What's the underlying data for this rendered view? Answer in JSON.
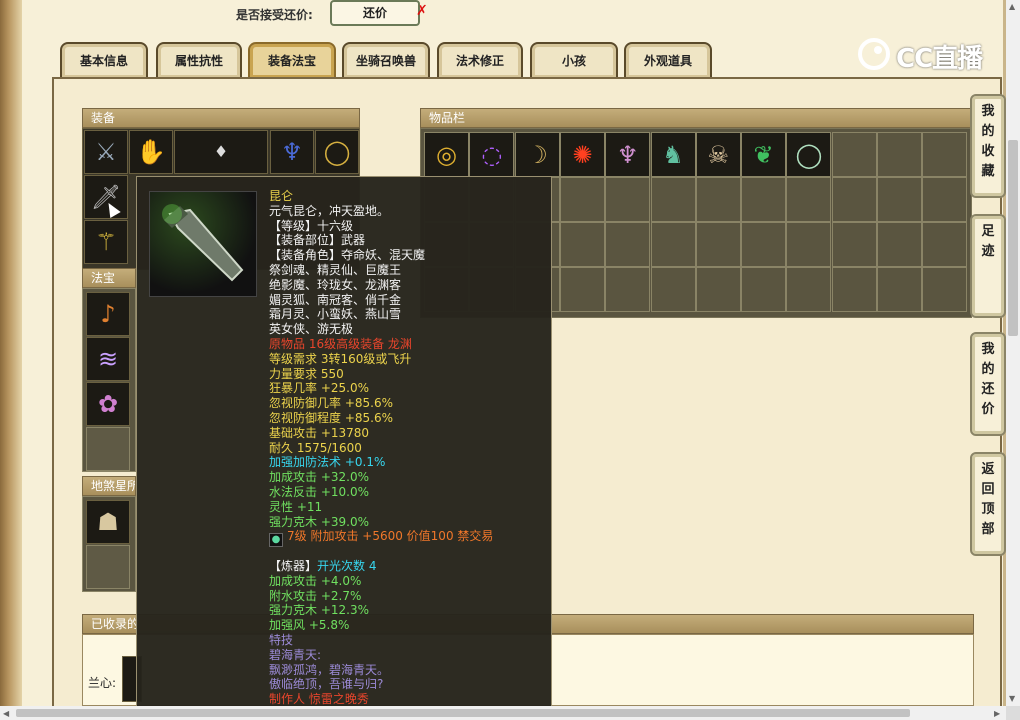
{
  "accept_offer_label": "是否接受还价:",
  "counter_offer_button": "还价",
  "tabs": [
    "基本信息",
    "属性抗性",
    "装备法宝",
    "坐骑召唤兽",
    "法术修正",
    "小孩",
    "外观道具"
  ],
  "active_tab": "装备法宝",
  "logo": "CC直播",
  "sections": {
    "equipment": "装备",
    "inventory": "物品栏",
    "fabao": "法宝",
    "earth_star": "地煞星所",
    "collected": "已收录的",
    "collected_name": "兰心:"
  },
  "tooltip": {
    "lines": [
      {
        "text": "昆仑",
        "color": "yellow"
      },
      {
        "text": "元气昆仑，冲天盈地。",
        "color": "white"
      },
      {
        "text": "【等级】十六级",
        "color": "white"
      },
      {
        "text": "【装备部位】武器",
        "color": "white"
      },
      {
        "text": "【装备角色】夺命妖、混天魔",
        "color": "white"
      },
      {
        "text": "祭剑魂、精灵仙、巨魔王",
        "color": "white"
      },
      {
        "text": "绝影魔、玲珑女、龙渊客",
        "color": "white"
      },
      {
        "text": "媚灵狐、南冠客、俏千金",
        "color": "white"
      },
      {
        "text": "霜月灵、小蛮妖、燕山雪",
        "color": "white"
      },
      {
        "text": "英女侠、游无极",
        "color": "white"
      },
      {
        "text": "原物品 16级高级装备 龙渊",
        "color": "red"
      },
      {
        "text": "等级需求 3转160级或飞升",
        "color": "yellow"
      },
      {
        "text": "力量要求 550",
        "color": "yellow"
      },
      {
        "text": "狂暴几率 +25.0%",
        "color": "yellow"
      },
      {
        "text": "忽视防御几率 +85.6%",
        "color": "yellow"
      },
      {
        "text": "忽视防御程度 +85.6%",
        "color": "yellow"
      },
      {
        "text": "基础攻击 +13780",
        "color": "yellow"
      },
      {
        "text": "耐久 1575/1600",
        "color": "yellow"
      },
      {
        "text": "加强加防法术 +0.1%",
        "color": "cyan"
      },
      {
        "text": "加成攻击 +32.0%",
        "color": "green"
      },
      {
        "text": "水法反击 +10.0%",
        "color": "green"
      },
      {
        "text": "灵性 +11",
        "color": "green"
      },
      {
        "text": "强力克木 +39.0%",
        "color": "green"
      },
      {
        "text": "7级 附加攻击 +5600 价值100 禁交易",
        "color": "orange",
        "gem": true
      },
      {
        "text": "",
        "color": "white"
      },
      {
        "text": "【炼器】开光次数 4",
        "color": "cyan",
        "prefix": "【炼器】",
        "prefix_color": "white"
      },
      {
        "text": "加成攻击 +4.0%",
        "color": "green"
      },
      {
        "text": "附水攻击 +2.7%",
        "color": "green"
      },
      {
        "text": "强力克木 +12.3%",
        "color": "green"
      },
      {
        "text": "加强风 +5.8%",
        "color": "green"
      },
      {
        "text": "特技",
        "color": "purple"
      },
      {
        "text": "碧海青天:",
        "color": "purple"
      },
      {
        "text": "飘渺孤鸿，碧海青天。",
        "color": "purple"
      },
      {
        "text": "傲临绝顶，吾谁与归?",
        "color": "purple"
      },
      {
        "text": "制作人 惊雷之晚秀",
        "color": "red"
      }
    ]
  },
  "side_buttons": [
    "我的收藏",
    "足迹",
    "我的还价",
    "返回顶部"
  ],
  "colors": {
    "tooltip_bg": "#26241c",
    "yellow": "#ecd34c",
    "red": "#e8452c",
    "green": "#70e060",
    "cyan": "#37d6ee",
    "orange": "#f0772a",
    "purple": "#9b8ad6"
  },
  "equipment_icons": [
    "sword-hilt-icon",
    "claw-glove-icon",
    "hairpin-icon",
    "blue-mask-icon",
    "gold-bracelet-icon",
    "dagger-icon",
    "staff-icon"
  ],
  "inventory_icons": [
    "gold-ring-icon",
    "purple-necklace-icon",
    "curved-blade-icon",
    "red-medallion-icon",
    "jellyfish-icon",
    "green-boots-icon",
    "skull-icon",
    "green-mask-icon",
    "jade-bracelet-icon"
  ]
}
